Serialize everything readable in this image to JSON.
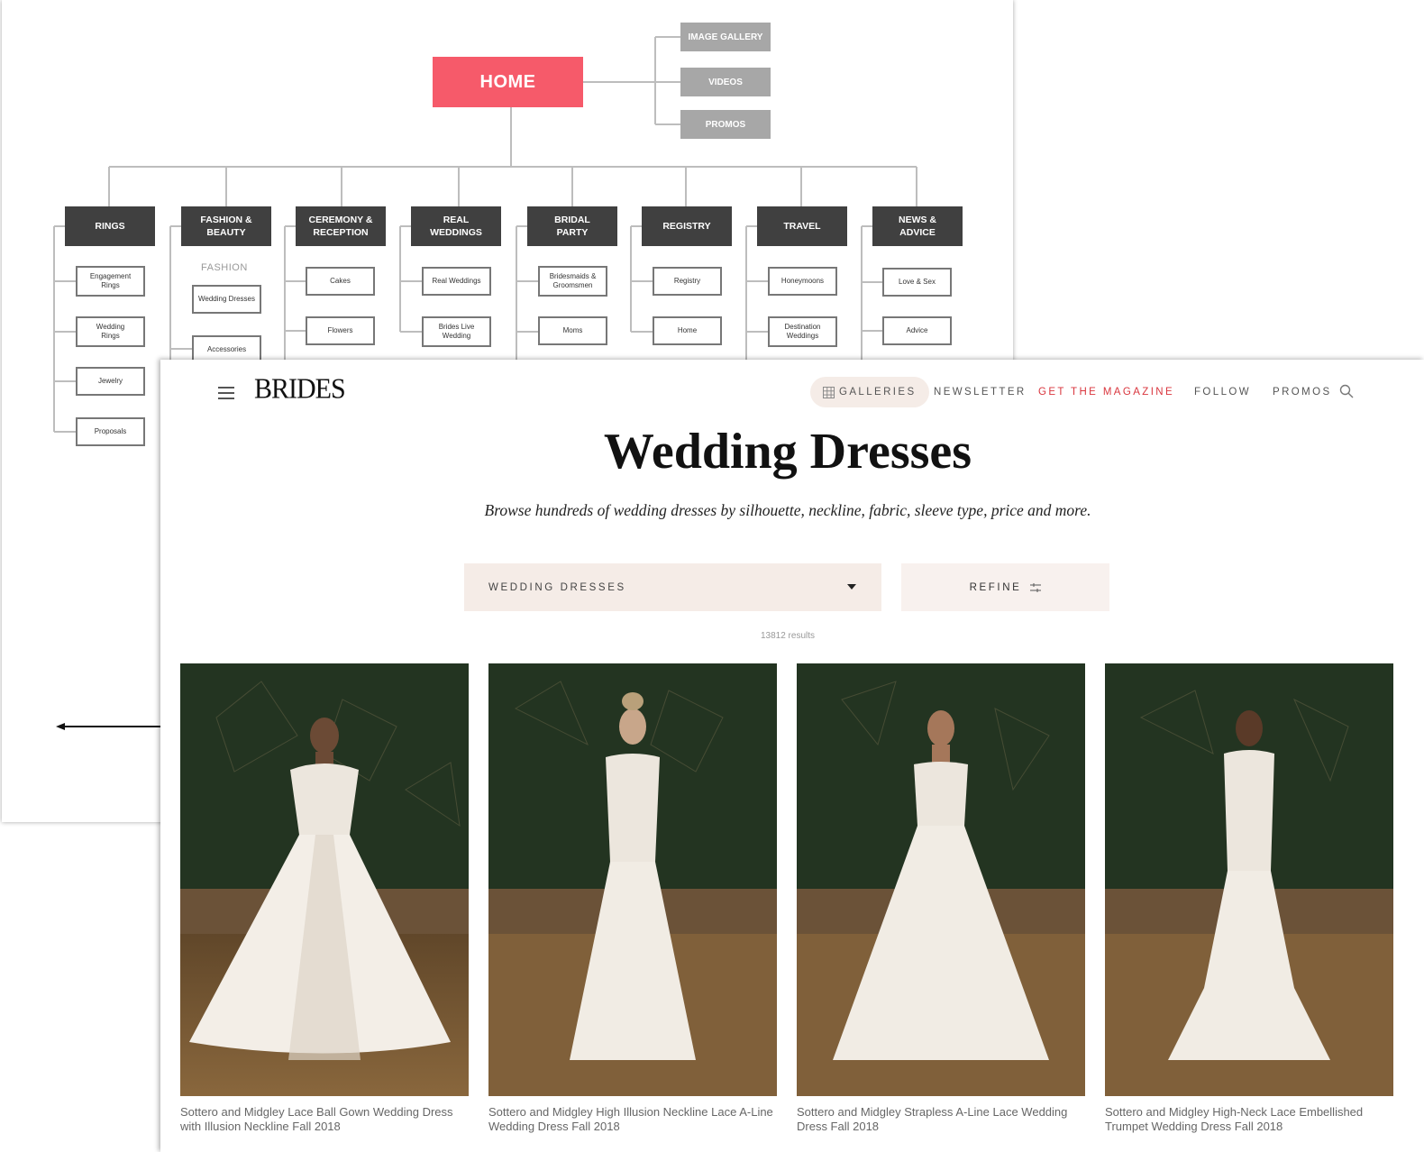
{
  "sitemap": {
    "home": "HOME",
    "side_items": [
      "IMAGE GALLERY",
      "VIDEOS",
      "PROMOS"
    ],
    "fashion_group_label": "FASHION",
    "categories": [
      {
        "label": "RINGS",
        "children": [
          "Engagement Rings",
          "Wedding Rings",
          "Jewelry",
          "Proposals"
        ]
      },
      {
        "label": "FASHION & BEAUTY",
        "children": [
          "Wedding Dresses",
          "Accessories"
        ]
      },
      {
        "label": "CEREMONY & RECEPTION",
        "children": [
          "Cakes",
          "Flowers"
        ]
      },
      {
        "label": "REAL WEDDINGS",
        "children": [
          "Real Weddings",
          "Brides Live Wedding"
        ]
      },
      {
        "label": "BRIDAL PARTY",
        "children": [
          "Bridesmaids & Groomsmen",
          "Moms"
        ]
      },
      {
        "label": "REGISTRY",
        "children": [
          "Registry",
          "Home"
        ]
      },
      {
        "label": "TRAVEL",
        "children": [
          "Honeymoons",
          "Destination Weddings"
        ]
      },
      {
        "label": "NEWS & ADVICE",
        "children": [
          "Love & Sex",
          "Advice"
        ]
      }
    ]
  },
  "header": {
    "logo": "BRIDES",
    "nav": {
      "galleries": "GALLERIES",
      "newsletter": "NEWSLETTER",
      "magazine": "GET THE MAGAZINE",
      "follow": "FOLLOW",
      "promos": "PROMOS"
    }
  },
  "main": {
    "title": "Wedding Dresses",
    "subtitle": "Browse hundreds of wedding dresses by silhouette, neckline, fabric, sleeve type, price and more.",
    "category_select": "WEDDING DRESSES",
    "refine_label": "REFINE",
    "results": "13812 results"
  },
  "products": [
    {
      "caption": "Sottero and Midgley Lace Ball Gown Wedding Dress with Illusion Neckline Fall 2018"
    },
    {
      "caption": "Sottero and Midgley High Illusion Neckline Lace A-Line Wedding Dress Fall 2018"
    },
    {
      "caption": "Sottero and Midgley Strapless A-Line Lace Wedding Dress Fall 2018"
    },
    {
      "caption": "Sottero and Midgley High-Neck Lace Embellished Trumpet Wedding Dress Fall 2018"
    }
  ],
  "colors": {
    "home_node": "#f65a6a",
    "category_node": "#404040",
    "side_node": "#a7a7a7",
    "accent_red": "#d9363e",
    "pill_bg": "#f5ece7"
  }
}
